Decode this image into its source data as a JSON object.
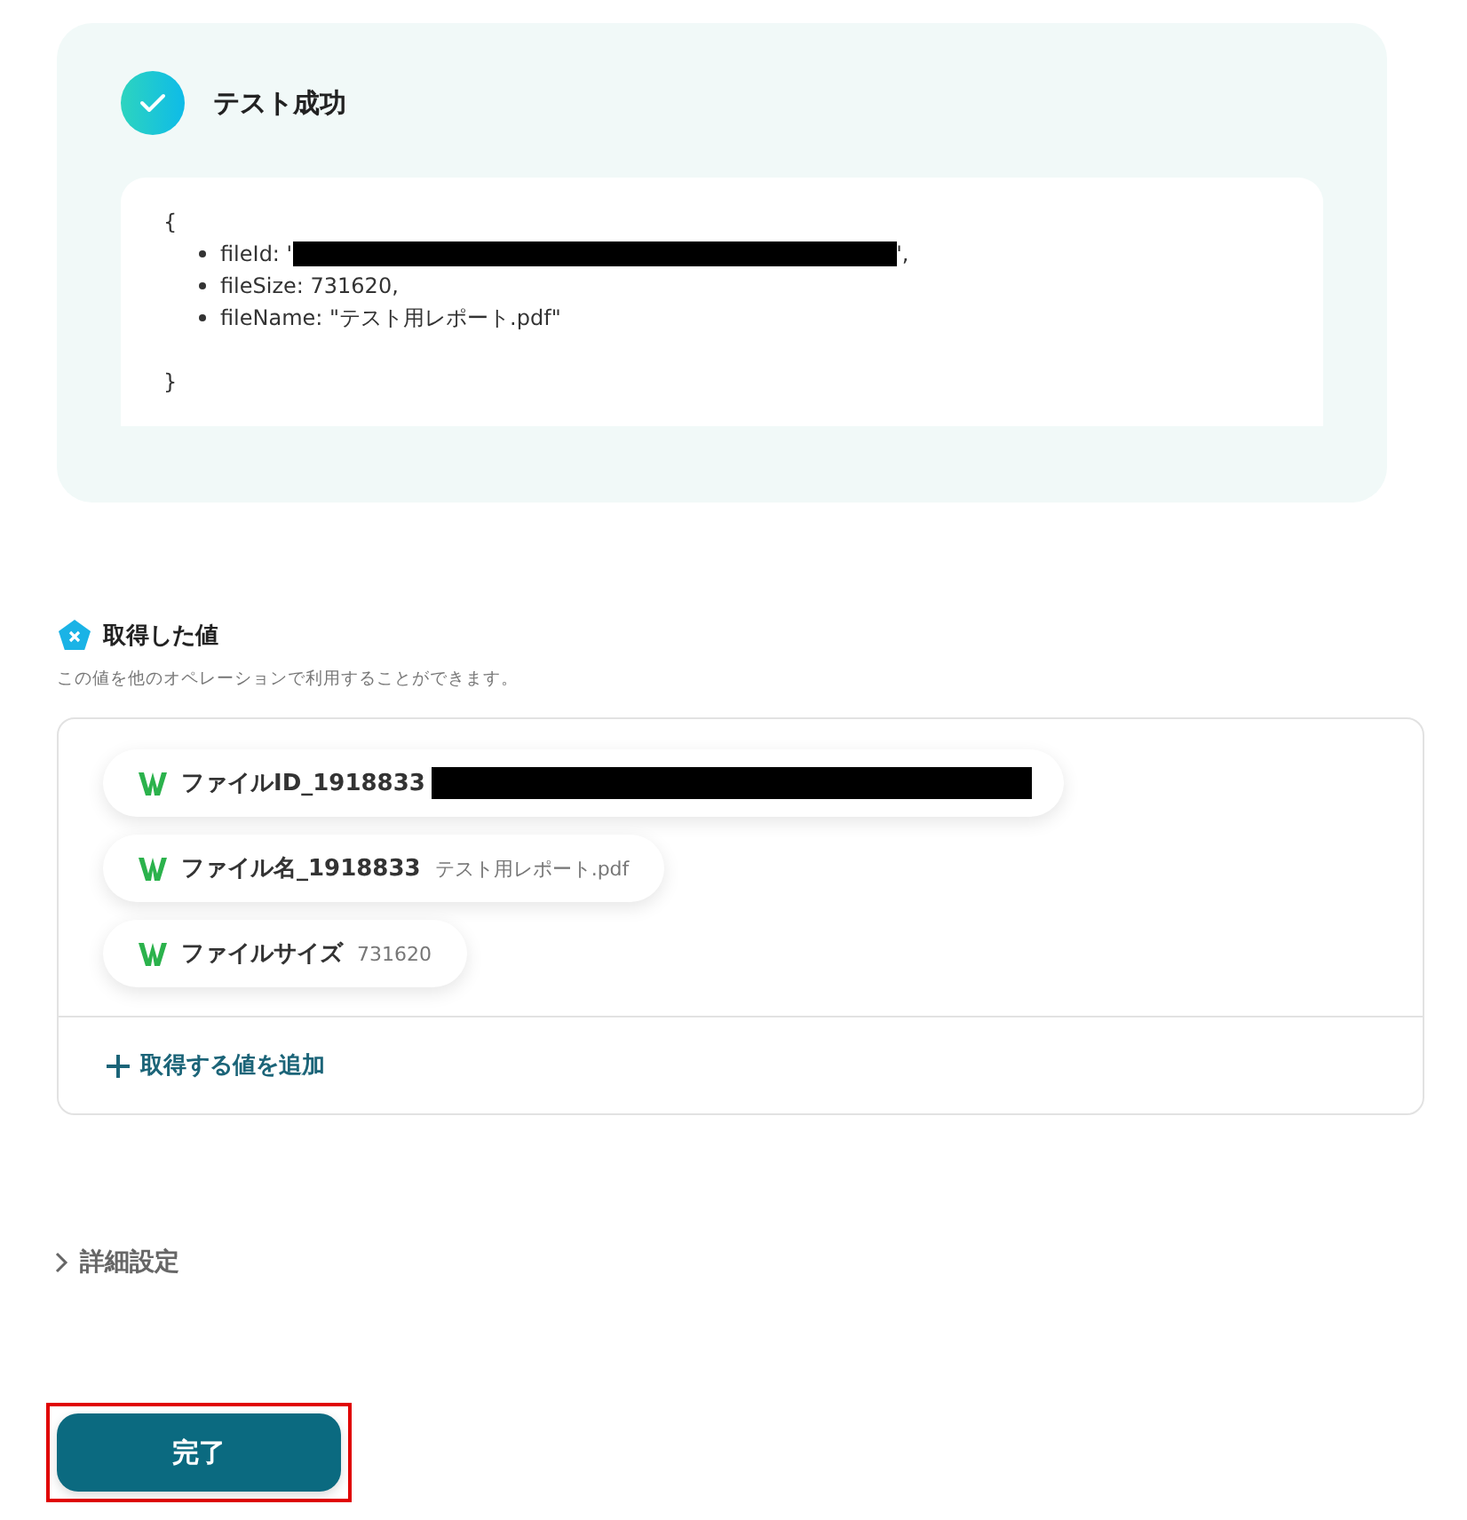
{
  "test_result": {
    "title": "テスト成功",
    "open_brace": "{",
    "close_brace": "}",
    "lines": [
      {
        "before": "fileId: '",
        "redacted": true,
        "after": "',"
      },
      {
        "before": "fileSize: 731620,",
        "redacted": false
      },
      {
        "before": "fileName: \"テスト用レポート.pdf\"",
        "redacted": false
      }
    ]
  },
  "values_section": {
    "title": "取得した値",
    "description": "この値を他のオペレーションで利用することができます。",
    "chips": [
      {
        "label": "ファイルID_1918833",
        "redacted": true
      },
      {
        "label": "ファイル名_1918833",
        "value": "テスト用レポート.pdf",
        "redacted": false
      },
      {
        "label": "ファイルサイズ",
        "value": "731620",
        "redacted": false
      }
    ],
    "add_link": "取得する値を追加"
  },
  "details": {
    "label": "詳細設定",
    "expanded": false
  },
  "done_button": {
    "label": "完了",
    "highlighted": true
  }
}
